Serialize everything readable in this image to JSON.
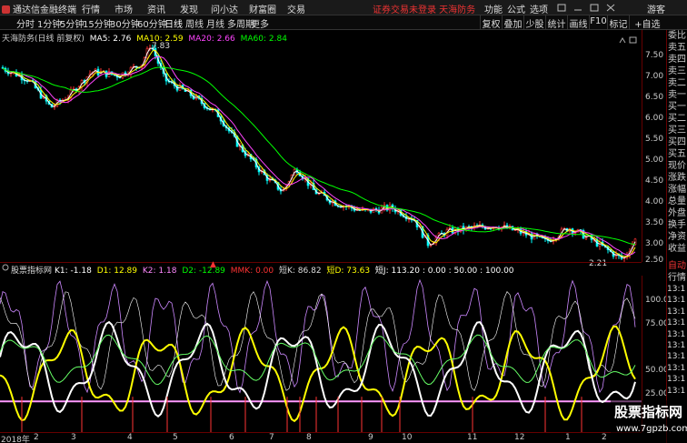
{
  "topbar": {
    "app_title": "通达信金融终端",
    "menu": [
      "行情",
      "市场",
      "资讯",
      "发现",
      "问小达",
      "财富圈",
      "交易"
    ],
    "notice": "证券交易未登录  天海防务",
    "right_menu": [
      "功能",
      "公式",
      "选项"
    ],
    "guest": "游客"
  },
  "toolbar": {
    "periods": [
      "分时",
      "1分钟",
      "5分钟",
      "15分钟",
      "30分钟",
      "60分钟",
      "日线",
      "周线",
      "月线",
      "多周期",
      "更多"
    ],
    "active_period": "日线",
    "buttons": [
      "复权",
      "叠加",
      "少股",
      "统计",
      "画线",
      "F10",
      "标记",
      "+自选"
    ]
  },
  "main_chart": {
    "stock_title": "天海防务(日线 前复权)",
    "ma": [
      {
        "label": "MA5: 2.76",
        "color": "#ffffff"
      },
      {
        "label": "MA10: 2.59",
        "color": "#ffff00"
      },
      {
        "label": "MA20: 2.66",
        "color": "#ff44ff"
      },
      {
        "label": "MA60: 2.84",
        "color": "#00ff00"
      }
    ],
    "high_label": "7.83",
    "low_label": "2.21",
    "y_ticks": [
      "7.50",
      "7.00",
      "6.50",
      "6.00",
      "5.50",
      "5.00",
      "4.50",
      "4.00",
      "3.50",
      "3.00",
      "2.50"
    ]
  },
  "indicator": {
    "title": "股票指标网",
    "params": [
      {
        "text": "K1: -1.18",
        "color": "#ffffff"
      },
      {
        "text": "D1: 12.89",
        "color": "#ffff00"
      },
      {
        "text": "K2: 1.18",
        "color": "#ff88ff"
      },
      {
        "text": "D2: -12.89",
        "color": "#00ff00"
      },
      {
        "text": "MMK: 0.00",
        "color": "#ff3333"
      },
      {
        "text": "短K: 86.82",
        "color": "#dddddd"
      },
      {
        "text": "短D: 73.63",
        "color": "#ffff00"
      },
      {
        "text": "短J: 113.20 : 0.00 : 50.00 : 100.00",
        "color": "#ffffff"
      }
    ],
    "y_ticks": [
      "100.0",
      "75.00",
      "50.00",
      "25.00"
    ]
  },
  "date_axis": {
    "labels": [
      "2018年",
      "2",
      "3",
      "4",
      "5",
      "6",
      "7",
      "8",
      "9",
      "10",
      "11",
      "12",
      "1",
      "2"
    ]
  },
  "side_panel": {
    "items": [
      "委比",
      "卖五",
      "卖四",
      "卖三",
      "卖二",
      "卖一",
      "买一",
      "买二",
      "买三",
      "买四",
      "买五",
      "现价",
      "涨跌",
      "涨幅",
      "总量",
      "外盘",
      "换手",
      "净资",
      "收益",
      "自动",
      "行情"
    ],
    "times": [
      "13:1",
      "13:1",
      "13:1",
      "13:1",
      "13:1",
      "13:1",
      "13:1",
      "13:1",
      "13:1",
      "13:1"
    ]
  },
  "watermark": {
    "line1": "股票指标网",
    "line2": "www.7gpzb.com"
  },
  "colors": {
    "up": "#ff3333",
    "down": "#00ffff",
    "ma5": "#ffffff",
    "ma10": "#ffff00",
    "ma20": "#ff44ff",
    "ma60": "#00ff00"
  }
}
